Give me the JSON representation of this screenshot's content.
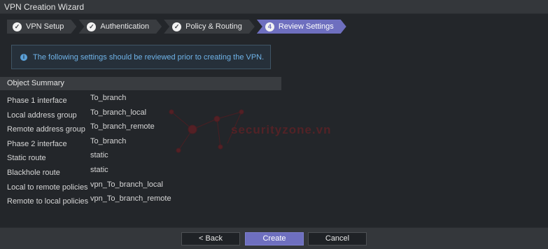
{
  "window": {
    "title": "VPN Creation Wizard"
  },
  "steps": [
    {
      "label": "VPN Setup",
      "mark": "✓",
      "active": false
    },
    {
      "label": "Authentication",
      "mark": "✓",
      "active": false
    },
    {
      "label": "Policy & Routing",
      "mark": "✓",
      "active": false
    },
    {
      "label": "Review Settings",
      "mark": "4",
      "active": true
    }
  ],
  "info": {
    "icon": "i",
    "text": "The following settings should be reviewed prior to creating the VPN."
  },
  "summary": {
    "header": "Object Summary",
    "rows": [
      {
        "key": "Phase 1 interface",
        "value": "To_branch"
      },
      {
        "key": "Local address group",
        "value": "To_branch_local"
      },
      {
        "key": "Remote address group",
        "value": "To_branch_remote"
      },
      {
        "key": "Phase 2 interface",
        "value": "To_branch"
      },
      {
        "key": "Static route",
        "value": "static"
      },
      {
        "key": "Blackhole route",
        "value": "static"
      },
      {
        "key": "Local to remote policies",
        "value": "vpn_To_branch_local"
      },
      {
        "key": "Remote to local policies",
        "value": "vpn_To_branch_remote"
      }
    ]
  },
  "watermark": {
    "text": "securityzone.vn"
  },
  "footer": {
    "back_label": "< Back",
    "create_label": "Create",
    "cancel_label": "Cancel"
  },
  "colors": {
    "accent": "#6e6fbf",
    "info_text": "#6fb3e8",
    "background": "#23262a"
  }
}
